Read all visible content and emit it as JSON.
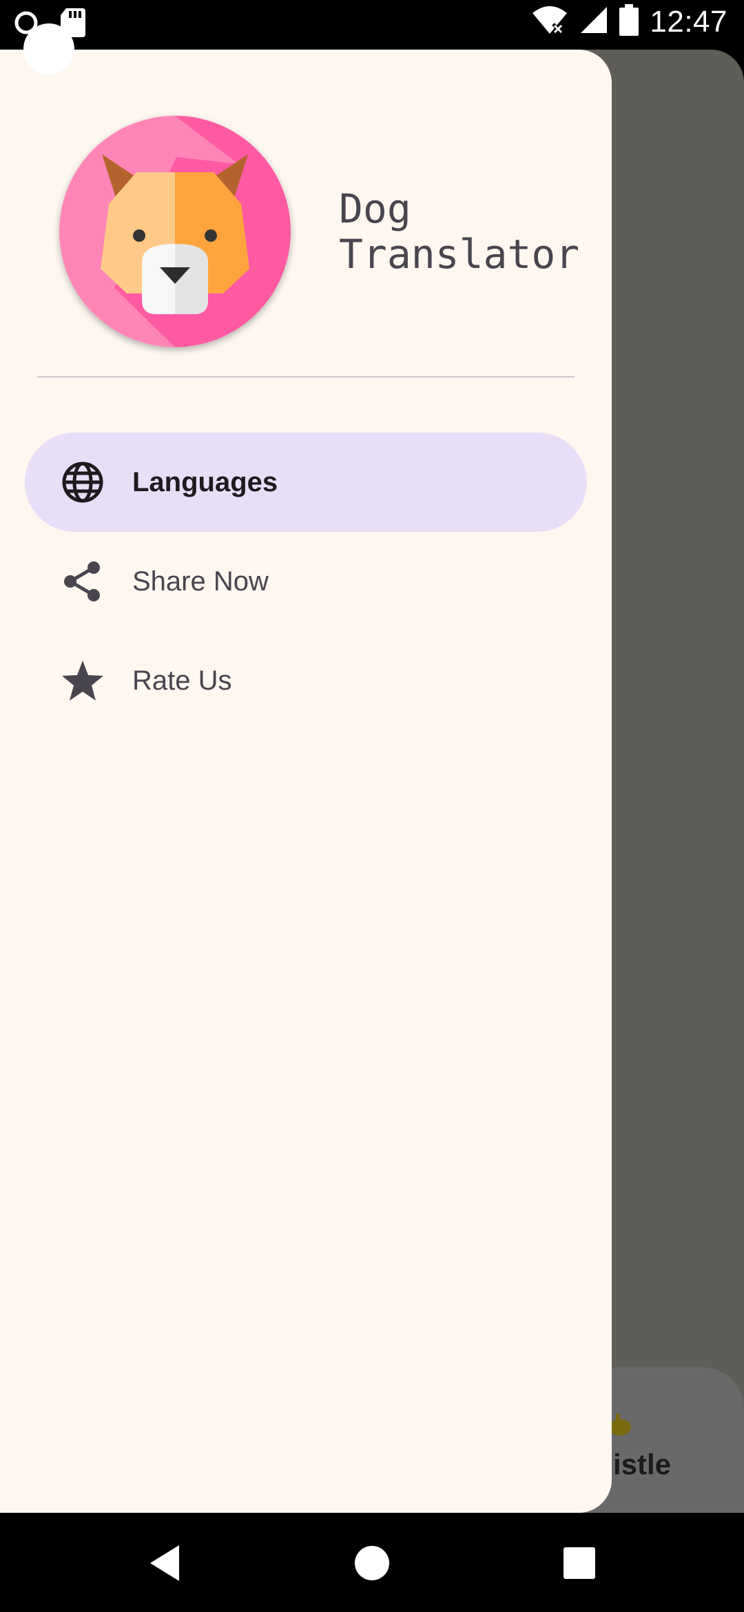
{
  "status_bar": {
    "time": "12:47",
    "icons": [
      "notification-dot-icon",
      "sd-card-icon",
      "wifi-off-icon",
      "signal-icon",
      "battery-icon"
    ]
  },
  "drawer": {
    "app_name": "Dog\nTranslator",
    "avatar_icon": "dog-face-icon",
    "menu": [
      {
        "label": "Languages",
        "icon": "globe-icon",
        "selected": true
      },
      {
        "label": "Share Now",
        "icon": "share-icon",
        "selected": false
      },
      {
        "label": "Rate Us",
        "icon": "star-icon",
        "selected": false
      }
    ]
  },
  "background_app": {
    "bottom_card_label": "istle"
  },
  "nav_bar": {
    "buttons": [
      "back-icon",
      "home-icon",
      "recents-icon"
    ]
  },
  "colors": {
    "drawer_bg": "#fdf7f0",
    "active_item_bg": "#e8def8",
    "scrim": "#5f5d57",
    "avatar_bg": "#ff5fa8"
  }
}
